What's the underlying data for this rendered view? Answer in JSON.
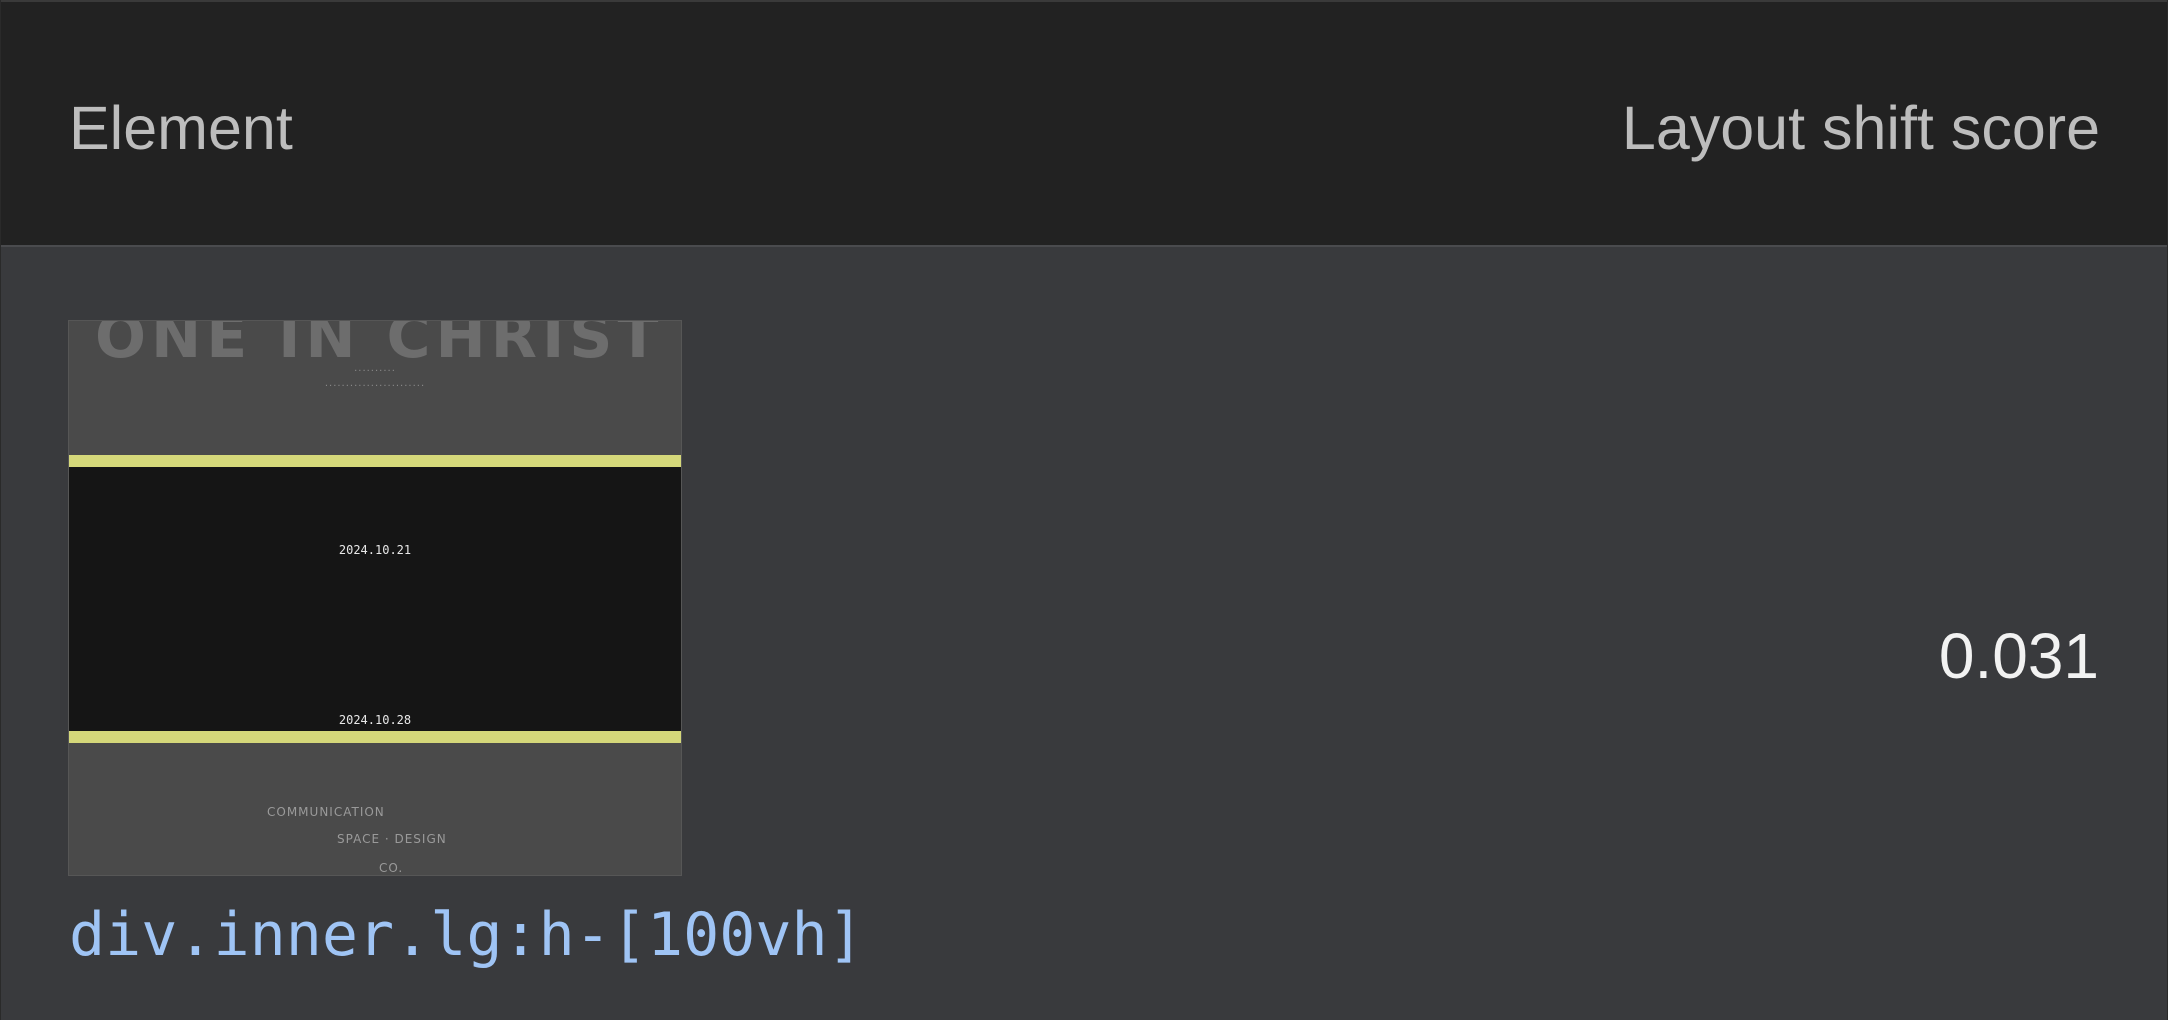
{
  "table": {
    "header": {
      "element_label": "Element",
      "score_label": "Layout shift score"
    },
    "rows": [
      {
        "selector": "div.inner.lg:h-[100vh]",
        "score": "0.031",
        "thumbnail": {
          "title": "ONE IN CHRIST",
          "dates": [
            "2024.10.21",
            "2024.10.28"
          ],
          "footer": [
            "COMMUNICATION",
            "SPACE · DESIGN",
            "CO."
          ]
        }
      }
    ]
  },
  "colors": {
    "header_bg": "#222222",
    "body_bg": "#393a3d",
    "selector_text": "#9fc4f5",
    "highlight_band": "#d5d87a"
  }
}
